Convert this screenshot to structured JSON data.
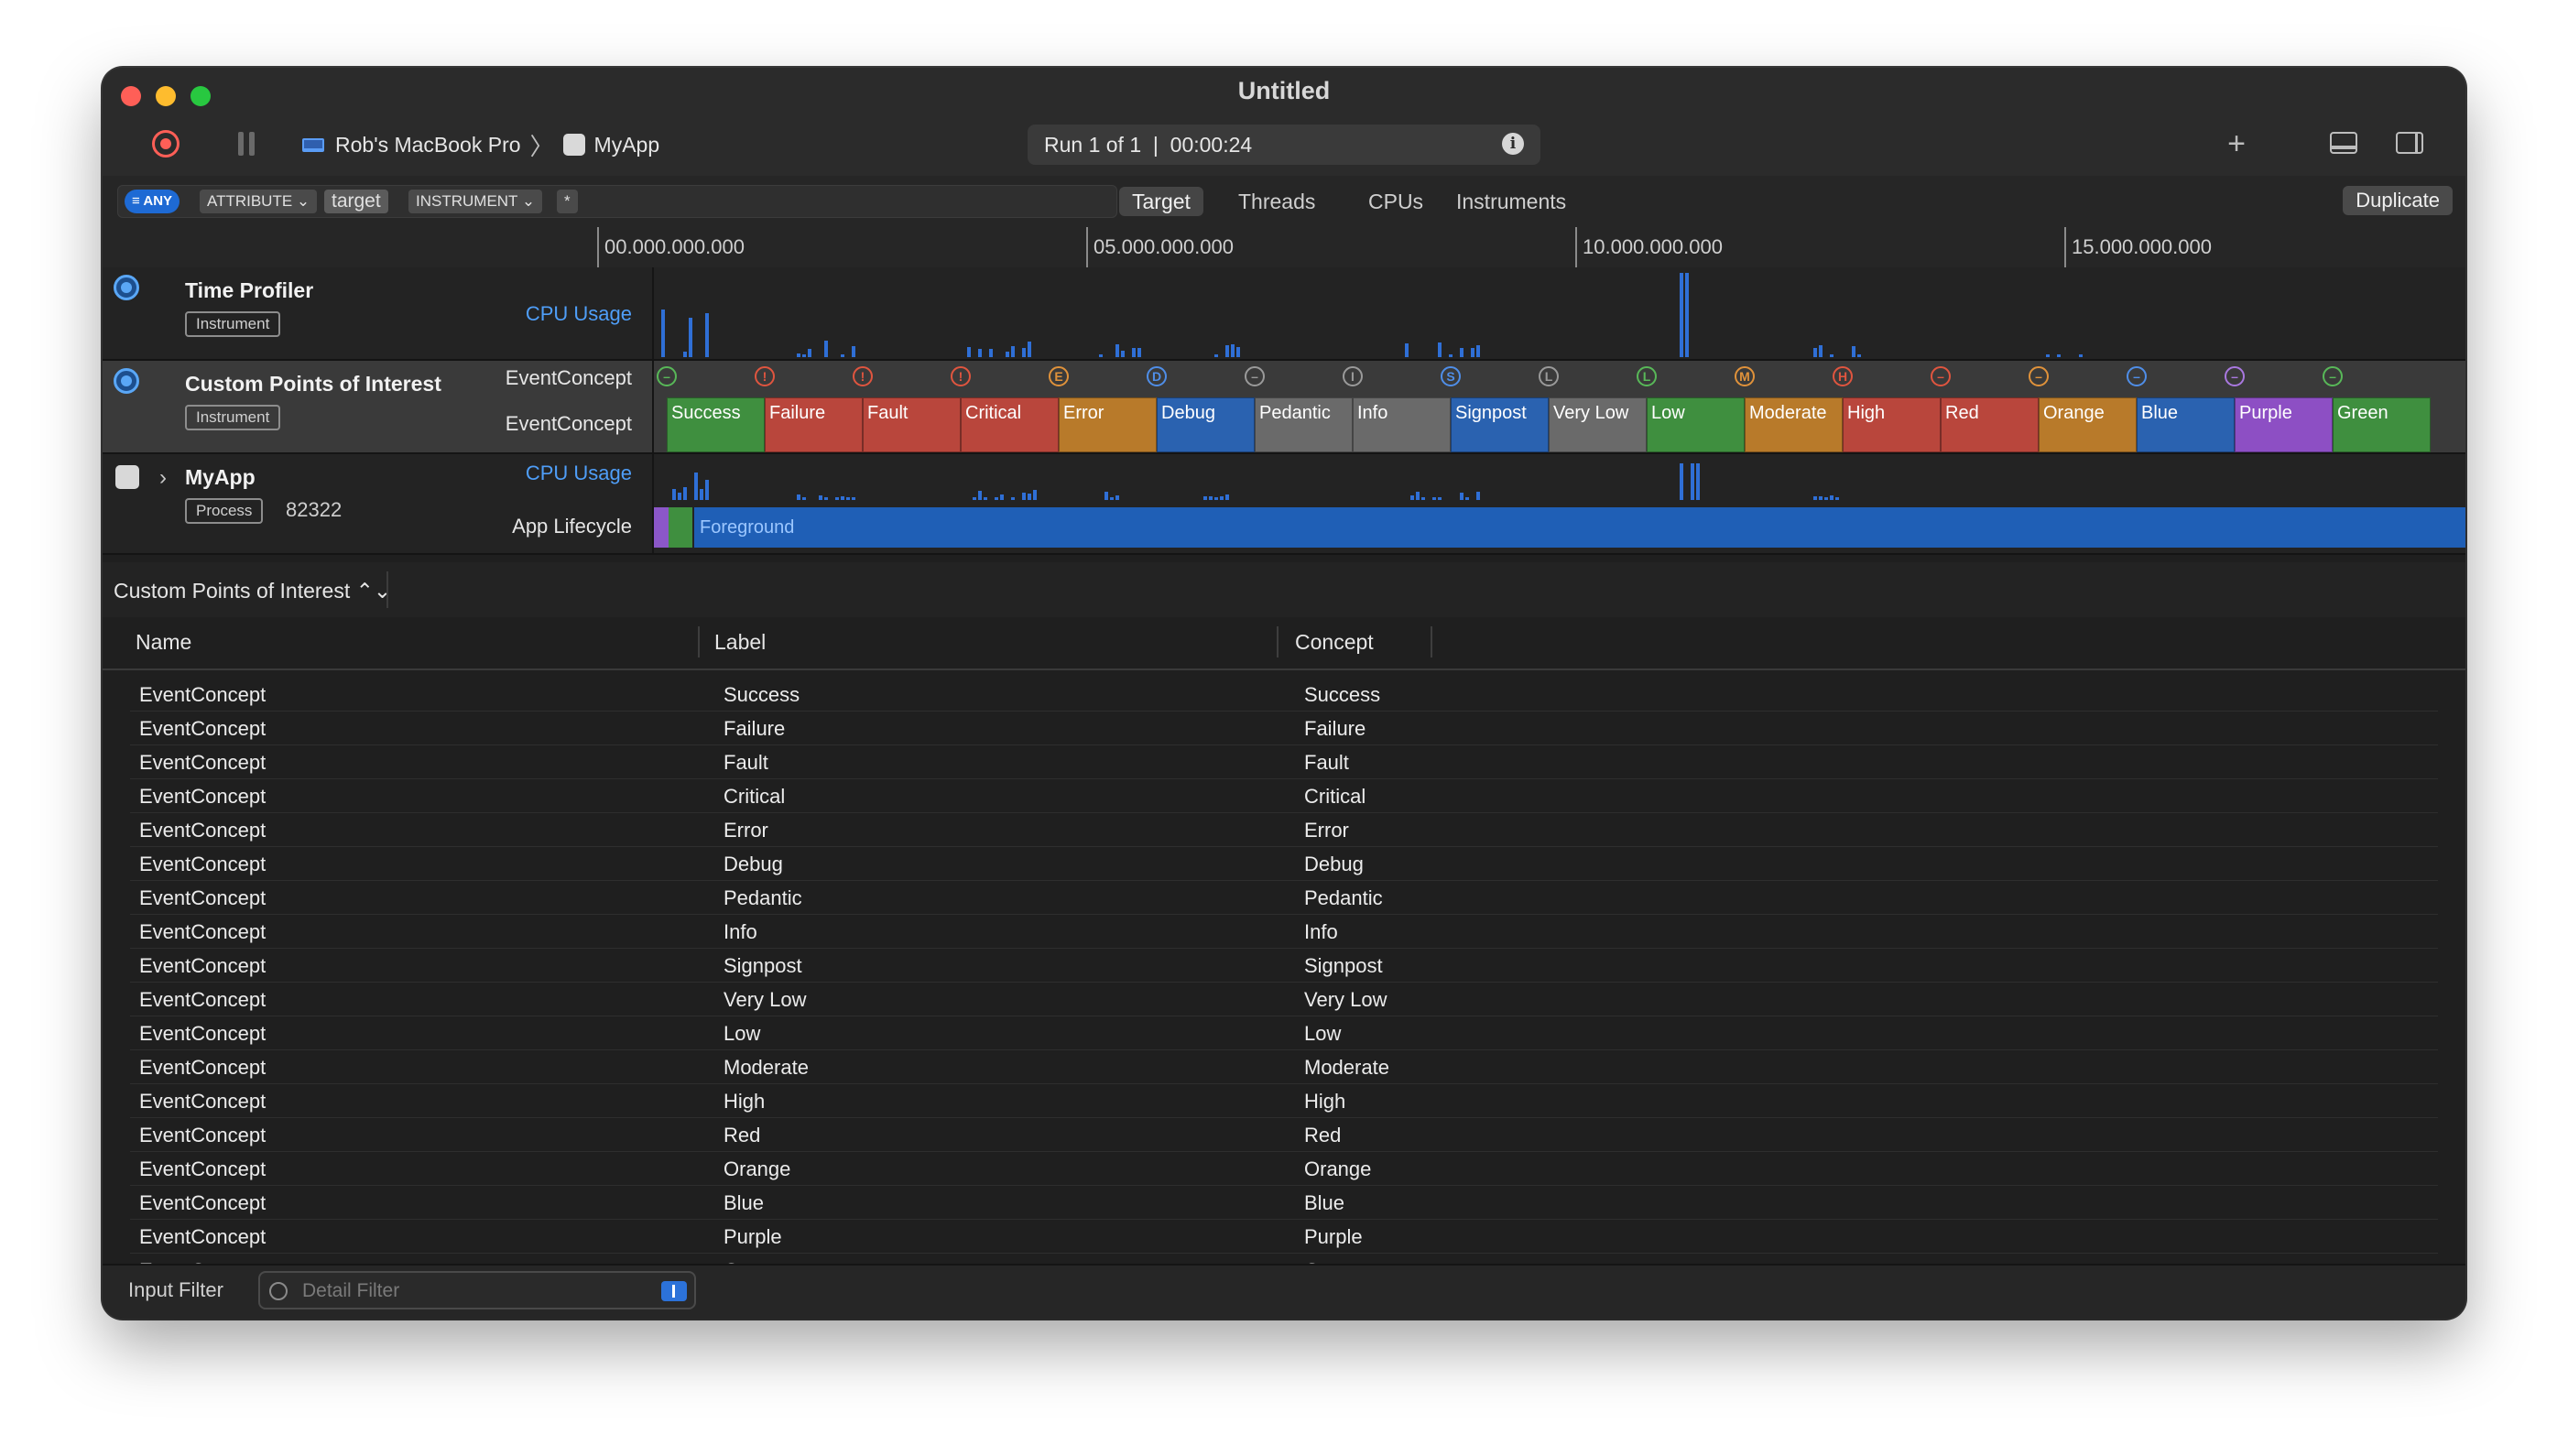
{
  "window": {
    "title": "Untitled"
  },
  "toolbar": {
    "device": "Rob's MacBook Pro",
    "app": "MyApp",
    "run_status": "Run 1 of 1  |  00:00:24",
    "add": "+"
  },
  "filter": {
    "any": "≡ ANY",
    "attribute": "ATTRIBUTE ⌄",
    "value": "target",
    "instrument": "INSTRUMENT ⌄",
    "star": "*"
  },
  "scope_tabs": [
    "Target",
    "Threads",
    "CPUs",
    "Instruments"
  ],
  "selected_tab": "Target",
  "duplicate_label": "Duplicate",
  "ruler": [
    "00.000.000.000",
    "05.000.000.000",
    "10.000.000.000",
    "15.000.000.000"
  ],
  "tracks": {
    "time_profiler": {
      "name": "Time Profiler",
      "badge": "Instrument",
      "lane": "CPU Usage"
    },
    "poi": {
      "name": "Custom Points of Interest",
      "badge": "Instrument",
      "lane1": "EventConcept",
      "lane2": "EventConcept"
    },
    "myapp": {
      "name": "MyApp",
      "badge": "Process",
      "pid": "82322",
      "lane1": "CPU Usage",
      "lane2": "App Lifecycle",
      "lifecycle_state": "Foreground"
    }
  },
  "poi_intervals": [
    {
      "label": "Success",
      "glyph": "–",
      "color": "#3f8f3f",
      "icon": "#58b858"
    },
    {
      "label": "Failure",
      "glyph": "!",
      "color": "#b9463c",
      "icon": "#e0553f"
    },
    {
      "label": "Fault",
      "glyph": "!",
      "color": "#b9463c",
      "icon": "#e0553f"
    },
    {
      "label": "Critical",
      "glyph": "!",
      "color": "#b9463c",
      "icon": "#e0553f"
    },
    {
      "label": "Error",
      "glyph": "E",
      "color": "#b87a2a",
      "icon": "#e0923a"
    },
    {
      "label": "Debug",
      "glyph": "D",
      "color": "#2a62b0",
      "icon": "#4f8ee8"
    },
    {
      "label": "Pedantic",
      "glyph": "–",
      "color": "#6a6a6a",
      "icon": "#9a9a9a"
    },
    {
      "label": "Info",
      "glyph": "I",
      "color": "#6a6a6a",
      "icon": "#9a9a9a"
    },
    {
      "label": "Signpost",
      "glyph": "S",
      "color": "#2a62b0",
      "icon": "#4f8ee8"
    },
    {
      "label": "Very Low",
      "glyph": "L",
      "color": "#6a6a6a",
      "icon": "#9a9a9a"
    },
    {
      "label": "Low",
      "glyph": "L",
      "color": "#3f8f3f",
      "icon": "#58b858"
    },
    {
      "label": "Moderate",
      "glyph": "M",
      "color": "#b87a2a",
      "icon": "#e0923a"
    },
    {
      "label": "High",
      "glyph": "H",
      "color": "#b9463c",
      "icon": "#e0553f"
    },
    {
      "label": "Red",
      "glyph": "–",
      "color": "#b9463c",
      "icon": "#e0553f"
    },
    {
      "label": "Orange",
      "glyph": "–",
      "color": "#b87a2a",
      "icon": "#e0923a"
    },
    {
      "label": "Blue",
      "glyph": "–",
      "color": "#2a62b0",
      "icon": "#4f8ee8"
    },
    {
      "label": "Purple",
      "glyph": "–",
      "color": "#8d4fc4",
      "icon": "#a978e0"
    },
    {
      "label": "Green",
      "glyph": "–",
      "color": "#3f8f3f",
      "icon": "#58b858"
    }
  ],
  "detail": {
    "scope": "Custom Points of Interest ⌃⌄",
    "columns": {
      "name": "Name",
      "label": "Label",
      "concept": "Concept"
    },
    "rows": [
      [
        "EventConcept",
        "Success",
        "Success"
      ],
      [
        "EventConcept",
        "Failure",
        "Failure"
      ],
      [
        "EventConcept",
        "Fault",
        "Fault"
      ],
      [
        "EventConcept",
        "Critical",
        "Critical"
      ],
      [
        "EventConcept",
        "Error",
        "Error"
      ],
      [
        "EventConcept",
        "Debug",
        "Debug"
      ],
      [
        "EventConcept",
        "Pedantic",
        "Pedantic"
      ],
      [
        "EventConcept",
        "Info",
        "Info"
      ],
      [
        "EventConcept",
        "Signpost",
        "Signpost"
      ],
      [
        "EventConcept",
        "Very Low",
        "Very Low"
      ],
      [
        "EventConcept",
        "Low",
        "Low"
      ],
      [
        "EventConcept",
        "Moderate",
        "Moderate"
      ],
      [
        "EventConcept",
        "High",
        "High"
      ],
      [
        "EventConcept",
        "Red",
        "Red"
      ],
      [
        "EventConcept",
        "Orange",
        "Orange"
      ],
      [
        "EventConcept",
        "Blue",
        "Blue"
      ],
      [
        "EventConcept",
        "Purple",
        "Purple"
      ],
      [
        "EventConcept",
        "Green",
        "Green"
      ]
    ]
  },
  "footer": {
    "input_filter": "Input Filter",
    "detail_filter_placeholder": "Detail Filter"
  }
}
